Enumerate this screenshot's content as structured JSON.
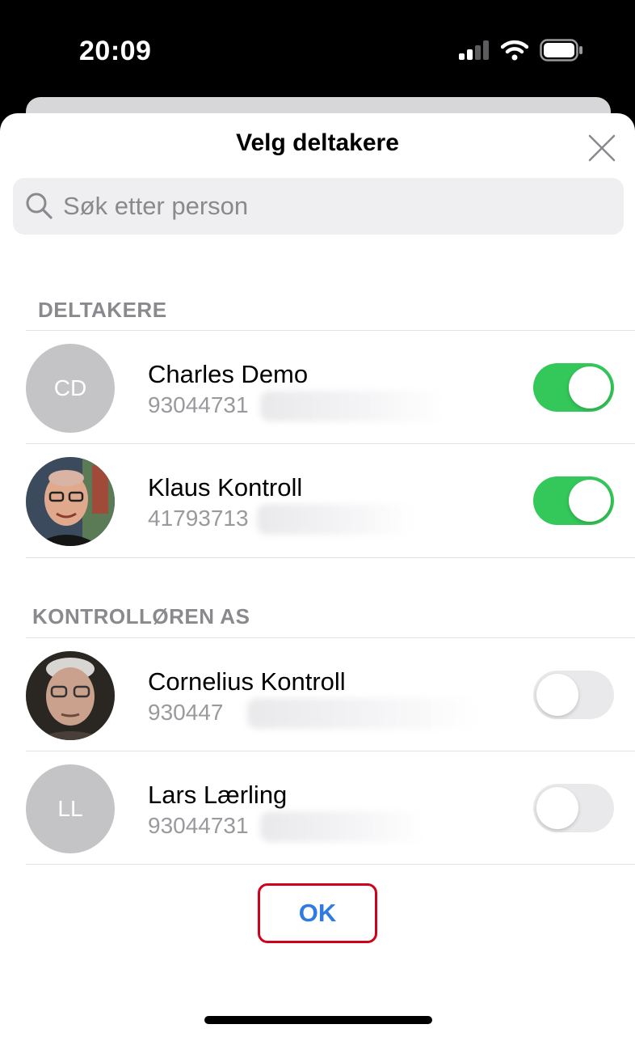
{
  "status_bar": {
    "time": "20:09",
    "icons": [
      "cellular-signal-icon",
      "wifi-icon",
      "battery-icon"
    ]
  },
  "sheet": {
    "title": "Velg deltakere",
    "close_icon": "close-icon"
  },
  "search": {
    "placeholder": "Søk etter person",
    "value": "",
    "icon": "search-icon"
  },
  "sections": [
    {
      "header": "DELTAKERE",
      "people": [
        {
          "name": "Charles Demo",
          "phone": "93044731",
          "initials": "CD",
          "photo": false,
          "selected": true
        },
        {
          "name": "Klaus Kontroll",
          "phone": "41793713",
          "initials": "",
          "photo": true,
          "selected": true
        }
      ]
    },
    {
      "header": "KONTROLLØREN AS",
      "people": [
        {
          "name": "Cornelius Kontroll",
          "phone": "930447",
          "initials": "",
          "photo": true,
          "selected": false
        },
        {
          "name": "Lars Lærling",
          "phone": "93044731",
          "initials": "LL",
          "photo": false,
          "selected": false
        }
      ]
    }
  ],
  "ok_button": {
    "label": "OK"
  },
  "colors": {
    "toggle_on": "#34c759",
    "toggle_off": "#e9e9eb",
    "ok_text": "#2f7be0",
    "ok_highlight_border": "#d0021b",
    "avatar_placeholder": "#c4c4c6"
  }
}
